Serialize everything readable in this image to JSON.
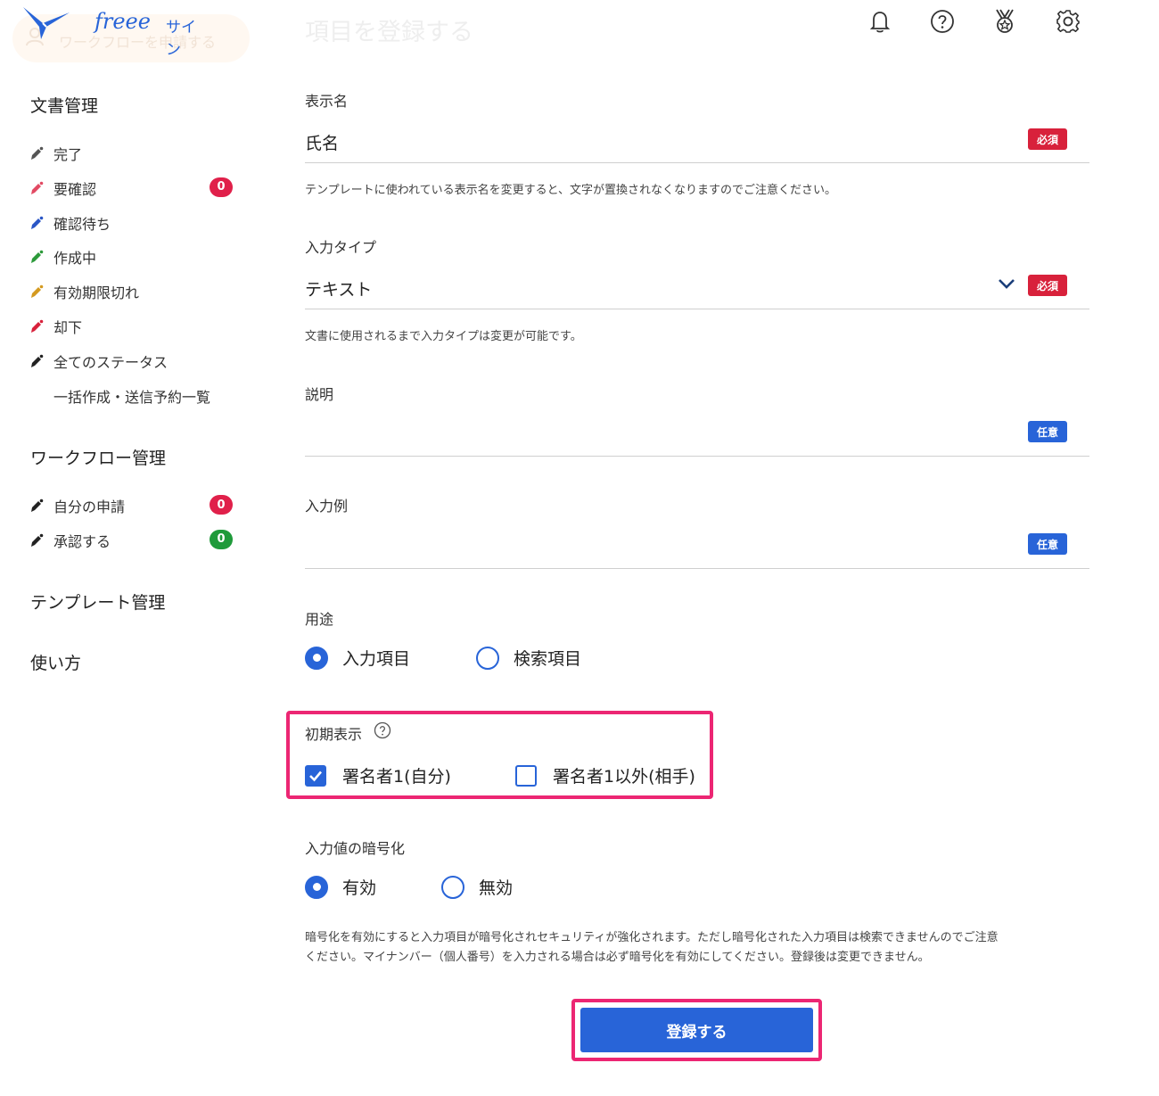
{
  "app": {
    "logo_text": "freee",
    "logo_sub": "サイン",
    "faded_button": "ワークフローを申請する",
    "faded_title": "項目を登録する"
  },
  "sidebar": {
    "sections": {
      "documents": "文書管理",
      "workflow": "ワークフロー管理",
      "templates": "テンプレート管理",
      "howto": "使い方"
    },
    "document_items": [
      {
        "label": "完了",
        "pen_color": "#555555"
      },
      {
        "label": "要確認",
        "pen_color": "#e24a63",
        "badge": "0"
      },
      {
        "label": "確認待ち",
        "pen_color": "#2a56c6"
      },
      {
        "label": "作成中",
        "pen_color": "#2c9a3a"
      },
      {
        "label": "有効期限切れ",
        "pen_color": "#d49a20"
      },
      {
        "label": "却下",
        "pen_color": "#d8213b"
      },
      {
        "label": "全てのステータス",
        "pen_color": "#222222"
      },
      {
        "label": "一括作成・送信予約一覧"
      }
    ],
    "workflow_items": [
      {
        "label": "自分の申請",
        "pen_color": "#222222",
        "badge": "0",
        "badge_color": "#e0204a"
      },
      {
        "label": "承認する",
        "pen_color": "#222222",
        "badge": "0",
        "badge_color": "#1f9a3a"
      }
    ]
  },
  "header_icons": [
    "bell-icon",
    "help-icon",
    "medal-icon",
    "gear-icon"
  ],
  "form": {
    "display_name": {
      "label": "表示名",
      "value": "氏名",
      "tag": "必須",
      "hint": "テンプレートに使われている表示名を変更すると、文字が置換されなくなりますのでご注意ください。"
    },
    "input_type": {
      "label": "入力タイプ",
      "value": "テキスト",
      "tag": "必須",
      "hint": "文書に使用されるまで入力タイプは変更が可能です。"
    },
    "description": {
      "label": "説明",
      "value": "",
      "tag": "任意"
    },
    "example": {
      "label": "入力例",
      "value": "",
      "tag": "任意"
    },
    "usage": {
      "label": "用途",
      "options": [
        "入力項目",
        "検索項目"
      ],
      "selected": "入力項目"
    },
    "initial_display": {
      "label": "初期表示",
      "options": [
        {
          "label": "署名者1(自分)",
          "checked": true
        },
        {
          "label": "署名者1以外(相手)",
          "checked": false
        }
      ]
    },
    "encryption": {
      "label": "入力値の暗号化",
      "options": [
        "有効",
        "無効"
      ],
      "selected": "有効",
      "hint_line1": "暗号化を有効にすると入力項目が暗号化されセキュリティが強化されます。ただし暗号化された入力項目は検索できませんのでご注意",
      "hint_line2": "ください。マイナンバー（個人番号）を入力される場合は必ず暗号化を有効にしてください。登録後は変更できません。"
    },
    "submit_label": "登録する"
  },
  "colors": {
    "primary": "#2864d8",
    "required": "#d8213b",
    "highlight": "#ec2673"
  }
}
